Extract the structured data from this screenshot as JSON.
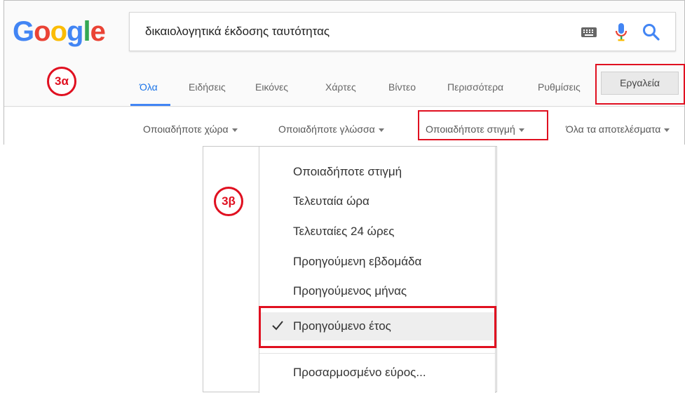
{
  "logo": {
    "letters": [
      "G",
      "o",
      "o",
      "g",
      "l",
      "e"
    ],
    "colors": [
      "#4285f4",
      "#ea4335",
      "#fbbc05",
      "#4285f4",
      "#34a853",
      "#ea4335"
    ]
  },
  "search": {
    "query": "δικαιολογητικά έκδοσης ταυτότητας",
    "keyboard_icon": "keyboard-icon",
    "mic_icon": "mic-icon",
    "search_icon": "search-icon"
  },
  "annotations": {
    "step_a": "3α",
    "step_b": "3β",
    "highlight_color": "#e01020"
  },
  "tabs": [
    {
      "label": "Όλα",
      "active": true
    },
    {
      "label": "Ειδήσεις"
    },
    {
      "label": "Εικόνες"
    },
    {
      "label": "Χάρτες"
    },
    {
      "label": "Βίντεο"
    },
    {
      "label": "Περισσότερα"
    },
    {
      "label": "Ρυθμίσεις"
    }
  ],
  "tools_label": "Εργαλεία",
  "filters": [
    {
      "label": "Οποιαδήποτε χώρα"
    },
    {
      "label": "Οποιαδήποτε γλώσσα"
    },
    {
      "label": "Οποιαδήποτε στιγμή"
    },
    {
      "label": "Όλα τα αποτελέσματα"
    }
  ],
  "time_menu": {
    "items": [
      {
        "label": "Οποιαδήποτε στιγμή"
      },
      {
        "label": "Τελευταία ώρα"
      },
      {
        "label": "Τελευταίες 24 ώρες"
      },
      {
        "label": "Προηγούμενη εβδομάδα"
      },
      {
        "label": "Προηγούμενος μήνας"
      },
      {
        "label": "Προηγούμενο έτος",
        "selected": true
      }
    ],
    "custom_range": "Προσαρμοσμένο εύρος..."
  }
}
